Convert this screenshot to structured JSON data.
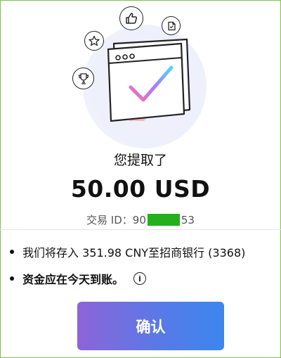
{
  "result": {
    "title": "您提取了",
    "amount": "50.00 USD",
    "transaction_label": "交易 ID：",
    "transaction_prefix": "90",
    "transaction_suffix": "53"
  },
  "details": [
    {
      "text": "我们将存入 351.98 CNY至招商银行 (3368)"
    },
    {
      "text": "资金应在今天到账。"
    }
  ],
  "actions": {
    "confirm_label": "确认"
  },
  "colors": {
    "accent_start": "#8d64d8",
    "accent_end": "#3c86ee",
    "id_mask": "#23b11b",
    "check_gradient": [
      "#ff6aa9",
      "#a77bff",
      "#4fd6ff"
    ]
  },
  "icons": [
    "thumbs-up-icon",
    "star-icon",
    "document-icon",
    "trophy-icon",
    "browser-window-icon",
    "checkmark-icon",
    "info-icon"
  ]
}
